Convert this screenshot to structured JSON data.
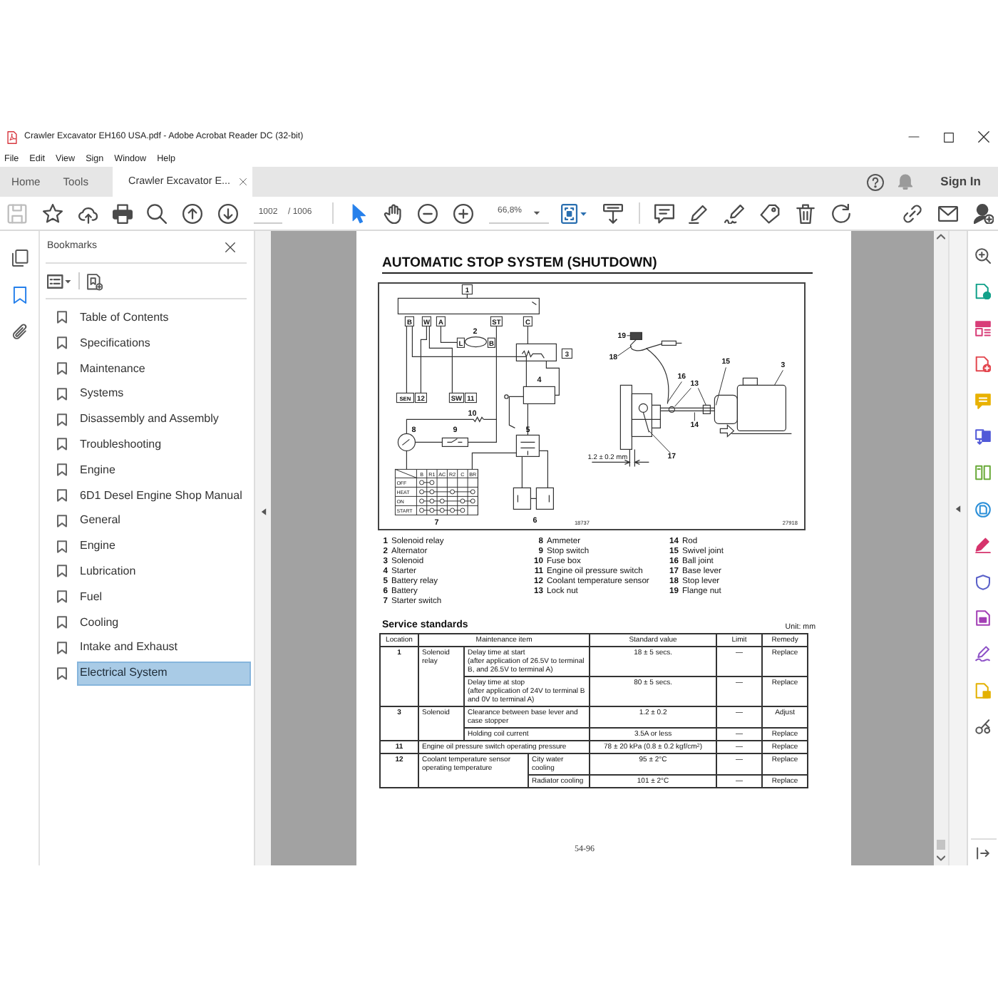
{
  "window": {
    "title": "Crawler Excavator EH160 USA.pdf - Adobe Acrobat Reader DC (32-bit)"
  },
  "menu": [
    "File",
    "Edit",
    "View",
    "Sign",
    "Window",
    "Help"
  ],
  "tabs": [
    {
      "kind": "page",
      "label": "Home",
      "selected": false
    },
    {
      "kind": "page",
      "label": "Tools",
      "selected": false
    },
    {
      "kind": "document",
      "label": "Crawler Excavator E...",
      "selected": true
    }
  ],
  "account": {
    "sign_in": "Sign In"
  },
  "toolbar": {
    "page_number": "1002",
    "page_count": "/ 1006",
    "zoom": "66,8%",
    "tools": [
      {
        "kind": "select",
        "selected": true
      },
      {
        "kind": "hand",
        "selected": false
      }
    ]
  },
  "left_rail": [
    {
      "kind": "pages",
      "selected": false
    },
    {
      "kind": "bookmarks",
      "selected": true
    },
    {
      "kind": "attachments",
      "selected": false
    }
  ],
  "bookmarks": {
    "title": "Bookmarks",
    "items": [
      {
        "label": "Table of Contents",
        "selected": false
      },
      {
        "label": "Specifications",
        "selected": false
      },
      {
        "label": "Maintenance",
        "selected": false
      },
      {
        "label": "Systems",
        "selected": false
      },
      {
        "label": "Disassembly and Assembly",
        "selected": false
      },
      {
        "label": "Troubleshooting",
        "selected": false
      },
      {
        "label": "Engine",
        "selected": false
      },
      {
        "label": "6D1 Desel Engine Shop Manual",
        "selected": false
      },
      {
        "label": "General",
        "selected": false
      },
      {
        "label": "Engine",
        "selected": false
      },
      {
        "label": "Lubrication",
        "selected": false
      },
      {
        "label": "Fuel",
        "selected": false
      },
      {
        "label": "Cooling",
        "selected": false
      },
      {
        "label": "Intake and Exhaust",
        "selected": false
      },
      {
        "label": "Electrical System",
        "selected": true
      }
    ]
  },
  "document": {
    "heading": "AUTOMATIC STOP SYSTEM (SHUTDOWN)",
    "diagram": {
      "wiring_labels": [
        "1",
        "B",
        "W",
        "A",
        "ST",
        "C",
        "2",
        "L",
        "B",
        "3",
        "4",
        "SEN",
        "12",
        "SW",
        "11",
        "10",
        "8",
        "9",
        "5",
        "6",
        "7"
      ],
      "switch_table": {
        "columns": [
          "B",
          "R1",
          "AC",
          "R2",
          "C",
          "BR"
        ],
        "rows": [
          "OFF",
          "HEAT",
          "ON",
          "START"
        ]
      },
      "mechanism_labels": [
        "19",
        "18",
        "16",
        "15",
        "3",
        "13",
        "14",
        "17",
        "1.2 ± 0.2 mm"
      ],
      "figure_numbers": [
        "18737",
        "27918"
      ]
    },
    "legend": {
      "columns": [
        [
          {
            "number": "1",
            "text": "Solenoid relay"
          },
          {
            "number": "2",
            "text": "Alternator"
          },
          {
            "number": "3",
            "text": "Solenoid"
          },
          {
            "number": "4",
            "text": "Starter"
          },
          {
            "number": "5",
            "text": "Battery relay"
          },
          {
            "number": "6",
            "text": "Battery"
          },
          {
            "number": "7",
            "text": "Starter switch"
          }
        ],
        [
          {
            "number": "8",
            "text": "Ammeter"
          },
          {
            "number": "9",
            "text": "Stop switch"
          },
          {
            "number": "10",
            "text": "Fuse box"
          },
          {
            "number": "11",
            "text": "Engine oil pressure switch"
          },
          {
            "number": "12",
            "text": "Coolant temperature sensor"
          },
          {
            "number": "13",
            "text": "Lock nut"
          }
        ],
        [
          {
            "number": "14",
            "text": "Rod"
          },
          {
            "number": "15",
            "text": "Swivel joint"
          },
          {
            "number": "16",
            "text": "Ball joint"
          },
          {
            "number": "17",
            "text": "Base lever"
          },
          {
            "number": "18",
            "text": "Stop lever"
          },
          {
            "number": "19",
            "text": "Flange nut"
          }
        ]
      ]
    },
    "service_standards": {
      "title": "Service standards",
      "unit": "Unit: mm",
      "columns": [
        "Location",
        "Maintenance item",
        "Standard value",
        "Limit",
        "Remedy"
      ],
      "groups": [
        {
          "kind": "component",
          "location": "1",
          "item": "Solenoid relay",
          "checks": [
            {
              "detail": "Delay time at start",
              "note": "(after application of 26.5V to terminal B, and 26.5V to terminal A)",
              "standard": "18 ± 5 secs.",
              "limit": "—",
              "remedy": "Replace"
            },
            {
              "detail": "Delay time at stop",
              "note": "(after application of 24V to terminal B and 0V to terminal A)",
              "standard": "80 ± 5 secs.",
              "limit": "—",
              "remedy": "Replace"
            }
          ]
        },
        {
          "kind": "component",
          "location": "3",
          "item": "Solenoid",
          "checks": [
            {
              "detail": "Clearance between base lever and case stopper",
              "standard": "1.2 ± 0.2",
              "limit": "—",
              "remedy": "Adjust"
            },
            {
              "detail": "Holding coil current",
              "standard": "3.5A or less",
              "limit": "—",
              "remedy": "Replace"
            }
          ]
        },
        {
          "kind": "single",
          "location": "11",
          "item": "Engine oil pressure switch operating pressure",
          "checks": [
            {
              "standard": "78 ± 20 kPa (0.8 ± 0.2 kgf/cm$^{2}$)",
              "limit": "—",
              "remedy": "Replace"
            }
          ]
        },
        {
          "kind": "condition",
          "location": "12",
          "item": "Coolant temperature sensor operating temperature",
          "checks": [
            {
              "detail": "City water cooling",
              "standard": "95 ± 2°C",
              "limit": "—",
              "remedy": "Replace"
            },
            {
              "detail": "Radiator cooling",
              "standard": "101 ± 2°C",
              "limit": "—",
              "remedy": "Replace"
            }
          ]
        }
      ]
    },
    "page_number": "54-96"
  }
}
